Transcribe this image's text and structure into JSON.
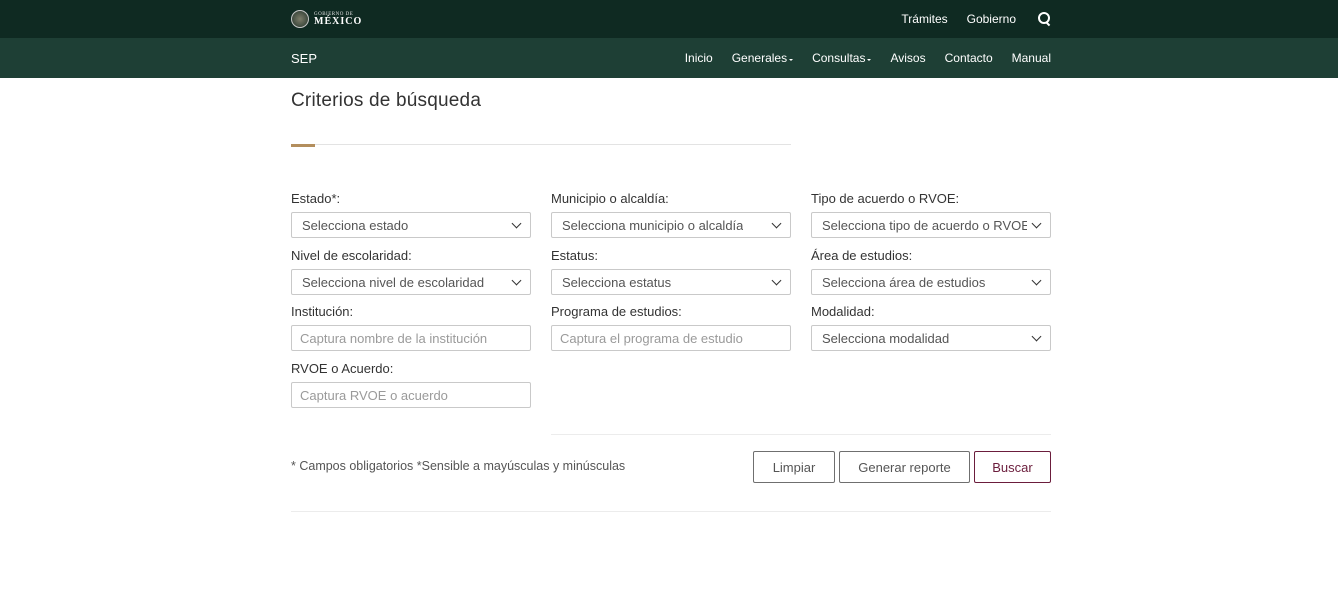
{
  "topbar": {
    "logo_small": "GOBIERNO DE",
    "logo_main": "MÉXICO",
    "links": [
      "Trámites",
      "Gobierno"
    ]
  },
  "subbar": {
    "brand": "SEP",
    "items": [
      {
        "label": "Inicio",
        "dropdown": false
      },
      {
        "label": "Generales",
        "dropdown": true
      },
      {
        "label": "Consultas",
        "dropdown": true
      },
      {
        "label": "Avisos",
        "dropdown": false
      },
      {
        "label": "Contacto",
        "dropdown": false
      },
      {
        "label": "Manual",
        "dropdown": false
      }
    ]
  },
  "main": {
    "title": "Criterios de búsqueda",
    "fields": {
      "estado": {
        "label": "Estado*:",
        "value": "Selecciona estado"
      },
      "municipio": {
        "label": "Municipio o alcaldía:",
        "value": "Selecciona municipio o alcaldía"
      },
      "tipo_acuerdo": {
        "label": "Tipo de acuerdo o RVOE:",
        "value": "Selecciona tipo de acuerdo o RVOE"
      },
      "nivel": {
        "label": "Nivel de escolaridad:",
        "value": "Selecciona nivel de escolaridad"
      },
      "estatus": {
        "label": "Estatus:",
        "value": "Selecciona estatus"
      },
      "area": {
        "label": "Área de estudios:",
        "value": "Selecciona área de estudios"
      },
      "institucion": {
        "label": "Institución:",
        "placeholder": "Captura nombre de la institución"
      },
      "programa": {
        "label": "Programa de estudios:",
        "placeholder": "Captura el programa de estudio"
      },
      "modalidad": {
        "label": "Modalidad:",
        "value": "Selecciona modalidad"
      },
      "rvoe": {
        "label": "RVOE o Acuerdo:",
        "placeholder": "Captura RVOE o acuerdo"
      }
    },
    "required_note": "* Campos obligatorios *Sensible a mayúsculas y minúsculas",
    "buttons": {
      "clear": "Limpiar",
      "report": "Generar reporte",
      "search": "Buscar"
    }
  },
  "colors": {
    "topbar_bg": "#0f2a22",
    "subbar_bg": "#1e3f35",
    "accent_gold": "#b38e5d",
    "accent_wine": "#6b1d3c"
  }
}
